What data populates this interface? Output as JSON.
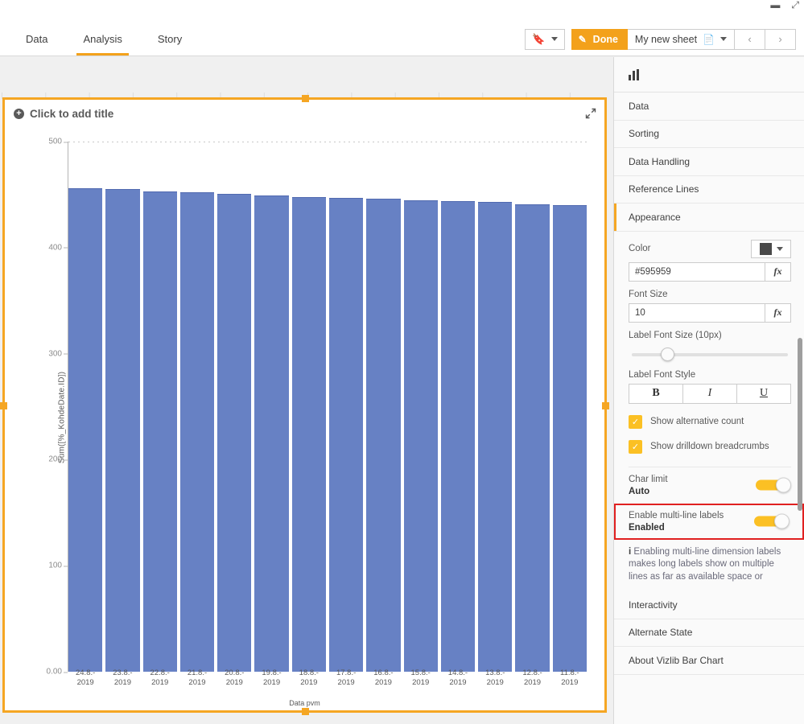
{
  "window": {
    "top_icons": [
      "minimize-icon",
      "maximize-icon"
    ]
  },
  "navbar": {
    "tabs": [
      {
        "label": "Data",
        "active": false
      },
      {
        "label": "Analysis",
        "active": true
      },
      {
        "label": "Story",
        "active": false
      }
    ],
    "bookmark_icon": "bookmark-icon",
    "done_label": "Done",
    "sheet_name": "My new sheet",
    "prev_label": "‹",
    "next_label": "›"
  },
  "object": {
    "title_placeholder": "Click to add title",
    "expand_icon": "expand-icon"
  },
  "chart_data": {
    "type": "bar",
    "title": "",
    "xlabel": "Data pvm",
    "ylabel": "Sum([%_KohdeDate.ID])",
    "ylim": [
      0,
      500
    ],
    "ytick_labels": [
      "500",
      "400",
      "300",
      "200",
      "100",
      "0.00"
    ],
    "ytick_values": [
      500,
      400,
      300,
      200,
      100,
      0
    ],
    "grid": true,
    "legend": "none",
    "bar_color": "#6781c4",
    "categories": [
      "24.8.-\n2019",
      "23.8.-\n2019",
      "22.8.-\n2019",
      "21.8.-\n2019",
      "20.8.-\n2019",
      "19.8.-\n2019",
      "18.8.-\n2019",
      "17.8.-\n2019",
      "16.8.-\n2019",
      "15.8.-\n2019",
      "14.8.-\n2019",
      "13.8.-\n2019",
      "12.8.-\n2019",
      "11.8.-\n2019"
    ],
    "category_lines": [
      [
        "24.8.-",
        "2019"
      ],
      [
        "23.8.-",
        "2019"
      ],
      [
        "22.8.-",
        "2019"
      ],
      [
        "21.8.-",
        "2019"
      ],
      [
        "20.8.-",
        "2019"
      ],
      [
        "19.8.-",
        "2019"
      ],
      [
        "18.8.-",
        "2019"
      ],
      [
        "17.8.-",
        "2019"
      ],
      [
        "16.8.-",
        "2019"
      ],
      [
        "15.8.-",
        "2019"
      ],
      [
        "14.8.-",
        "2019"
      ],
      [
        "13.8.-",
        "2019"
      ],
      [
        "12.8.-",
        "2019"
      ],
      [
        "11.8.-",
        "2019"
      ]
    ],
    "values": [
      456,
      455,
      453,
      452,
      451,
      449,
      448,
      447,
      446,
      445,
      444,
      443,
      441,
      440
    ]
  },
  "panel": {
    "header_icon": "bar-chart-icon",
    "accordion": [
      {
        "label": "Data",
        "active": false
      },
      {
        "label": "Sorting",
        "active": false
      },
      {
        "label": "Data Handling",
        "active": false
      },
      {
        "label": "Reference Lines",
        "active": false
      },
      {
        "label": "Appearance",
        "active": true
      }
    ],
    "appearance": {
      "color_label": "Color",
      "color_value": "#595959",
      "fx_label": "fx",
      "font_size_label": "Font Size",
      "font_size_value": "10",
      "label_font_size_label": "Label Font Size (10px)",
      "label_font_style_label": "Label Font Style",
      "style_bold": "B",
      "style_italic": "I",
      "style_underline": "U",
      "checkboxes": [
        {
          "label": "Show alternative count",
          "checked": true
        },
        {
          "label": "Show drilldown breadcrumbs",
          "checked": true
        }
      ],
      "toggles": [
        {
          "title": "Char limit",
          "state": "Auto",
          "on": true,
          "highlighted": false
        },
        {
          "title": "Enable multi-line labels",
          "state": "Enabled",
          "on": true,
          "highlighted": true
        }
      ],
      "info_marker": "i",
      "info_text": "Enabling multi-line dimension labels makes long labels show on multiple lines as far as available space or"
    },
    "accordion_bottom": [
      {
        "label": "Interactivity"
      },
      {
        "label": "Alternate State"
      },
      {
        "label": "About Vizlib Bar Chart"
      }
    ]
  },
  "colors": {
    "accent": "#f5a623",
    "bar": "#6781c4",
    "toggle_on": "#fbc024",
    "highlight_border": "#e02020"
  }
}
